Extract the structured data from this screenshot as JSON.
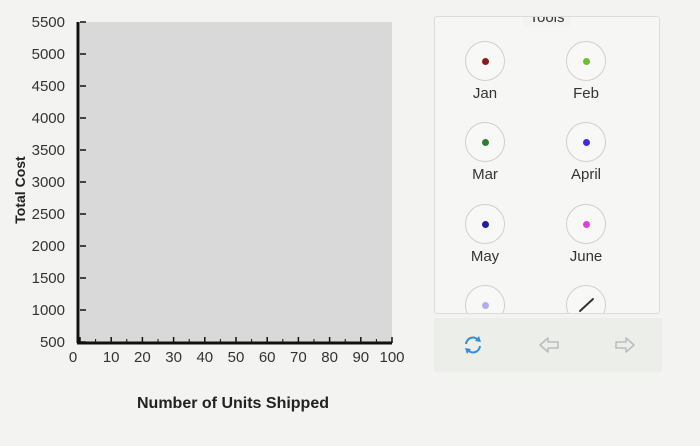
{
  "chart_data": {
    "type": "scatter",
    "title": "",
    "xlabel": "Number of Units Shipped",
    "ylabel": "Total Cost",
    "xlim": [
      0,
      100
    ],
    "ylim": [
      500,
      5500
    ],
    "xticks": [
      "0",
      "10",
      "20",
      "30",
      "40",
      "50",
      "60",
      "70",
      "80",
      "90",
      "100"
    ],
    "yticks": [
      "500",
      "1000",
      "1500",
      "2000",
      "2500",
      "3000",
      "3500",
      "4000",
      "4500",
      "5000",
      "5500"
    ],
    "series": [],
    "grid": false,
    "plot_area_color": "#d9d9d9"
  },
  "tools": {
    "title": "Tools",
    "items": [
      {
        "label": "Jan",
        "color": "#8b1a1a"
      },
      {
        "label": "Feb",
        "color": "#6bbf2a"
      },
      {
        "label": "Mar",
        "color": "#2e7d32"
      },
      {
        "label": "April",
        "color": "#3a2fd6"
      },
      {
        "label": "May",
        "color": "#1f1f9a"
      },
      {
        "label": "June",
        "color": "#e040e0"
      },
      {
        "label": "",
        "color": "#b0b0e8"
      },
      {
        "label": "",
        "color": "#333333",
        "icon": "line-tool-icon"
      }
    ]
  },
  "actions": {
    "reset_icon": "reset-icon",
    "undo_icon": "undo-icon",
    "redo_icon": "redo-icon",
    "accent": "#2f8fd8"
  }
}
